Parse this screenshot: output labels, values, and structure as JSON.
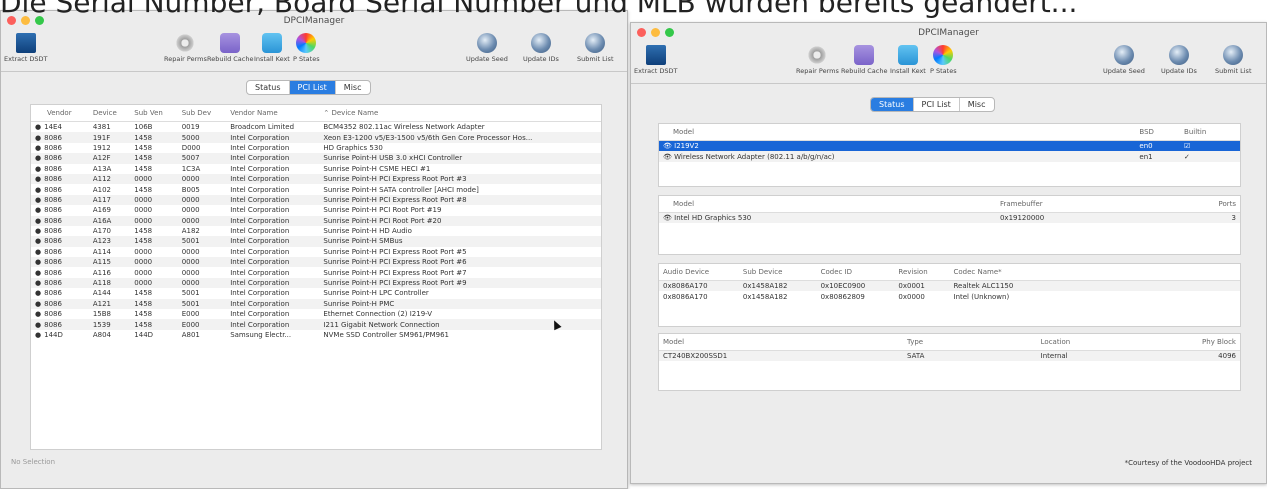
{
  "caption": "Die Serial Number, Board Serial Number und MLB wurden bereits geändert...",
  "left": {
    "title": "DPCIManager",
    "toolbar": [
      "Extract DSDT",
      "Repair Perms",
      "Rebuild Cache",
      "Install Kext",
      "P States",
      "Update Seed",
      "Update IDs",
      "Submit List"
    ],
    "tabs": [
      "Status",
      "PCI List",
      "Misc"
    ],
    "active_tab": "PCI List",
    "columns": [
      "Vendor",
      "Device",
      "Sub Ven",
      "Sub Dev",
      "Vendor Name",
      "Device Name"
    ],
    "rows": [
      [
        "14E4",
        "4381",
        "106B",
        "0019",
        "Broadcom Limited",
        "BCM4352 802.11ac Wireless Network Adapter"
      ],
      [
        "8086",
        "191F",
        "1458",
        "5000",
        "Intel Corporation",
        "Xeon E3-1200 v5/E3-1500 v5/6th Gen Core Processor Hos..."
      ],
      [
        "8086",
        "1912",
        "1458",
        "D000",
        "Intel Corporation",
        "HD Graphics 530"
      ],
      [
        "8086",
        "A12F",
        "1458",
        "5007",
        "Intel Corporation",
        "Sunrise Point-H USB 3.0 xHCI Controller"
      ],
      [
        "8086",
        "A13A",
        "1458",
        "1C3A",
        "Intel Corporation",
        "Sunrise Point-H CSME HECI #1"
      ],
      [
        "8086",
        "A112",
        "0000",
        "0000",
        "Intel Corporation",
        "Sunrise Point-H PCI Express Root Port #3"
      ],
      [
        "8086",
        "A102",
        "1458",
        "B005",
        "Intel Corporation",
        "Sunrise Point-H SATA controller [AHCI mode]"
      ],
      [
        "8086",
        "A117",
        "0000",
        "0000",
        "Intel Corporation",
        "Sunrise Point-H PCI Express Root Port #8"
      ],
      [
        "8086",
        "A169",
        "0000",
        "0000",
        "Intel Corporation",
        "Sunrise Point-H PCI Root Port #19"
      ],
      [
        "8086",
        "A16A",
        "0000",
        "0000",
        "Intel Corporation",
        "Sunrise Point-H PCI Root Port #20"
      ],
      [
        "8086",
        "A170",
        "1458",
        "A182",
        "Intel Corporation",
        "Sunrise Point-H HD Audio"
      ],
      [
        "8086",
        "A123",
        "1458",
        "5001",
        "Intel Corporation",
        "Sunrise Point-H SMBus"
      ],
      [
        "8086",
        "A114",
        "0000",
        "0000",
        "Intel Corporation",
        "Sunrise Point-H PCI Express Root Port #5"
      ],
      [
        "8086",
        "A115",
        "0000",
        "0000",
        "Intel Corporation",
        "Sunrise Point-H PCI Express Root Port #6"
      ],
      [
        "8086",
        "A116",
        "0000",
        "0000",
        "Intel Corporation",
        "Sunrise Point-H PCI Express Root Port #7"
      ],
      [
        "8086",
        "A118",
        "0000",
        "0000",
        "Intel Corporation",
        "Sunrise Point-H PCI Express Root Port #9"
      ],
      [
        "8086",
        "A144",
        "1458",
        "5001",
        "Intel Corporation",
        "Sunrise Point-H LPC Controller"
      ],
      [
        "8086",
        "A121",
        "1458",
        "5001",
        "Intel Corporation",
        "Sunrise Point-H PMC"
      ],
      [
        "8086",
        "15B8",
        "1458",
        "E000",
        "Intel Corporation",
        "Ethernet Connection (2) I219-V"
      ],
      [
        "8086",
        "1539",
        "1458",
        "E000",
        "Intel Corporation",
        "I211 Gigabit Network Connection"
      ],
      [
        "144D",
        "A804",
        "144D",
        "A801",
        "Samsung Electr...",
        "NVMe SSD Controller SM961/PM961"
      ]
    ],
    "status": "No Selection"
  },
  "right": {
    "title": "DPCIManager",
    "toolbar": [
      "Extract DSDT",
      "Repair Perms",
      "Rebuild Cache",
      "Install Kext",
      "P States",
      "Update Seed",
      "Update IDs",
      "Submit List"
    ],
    "tabs": [
      "Status",
      "PCI List",
      "Misc"
    ],
    "active_tab": "Status",
    "network": {
      "columns": [
        "Model",
        "BSD",
        "Builtin"
      ],
      "rows": [
        {
          "model": "I219V2",
          "bsd": "en0",
          "builtin": "☑"
        },
        {
          "model": "Wireless Network Adapter (802.11 a/b/g/n/ac)",
          "bsd": "en1",
          "builtin": "✓"
        }
      ]
    },
    "graphics": {
      "columns": [
        "Model",
        "Framebuffer",
        "Ports"
      ],
      "rows": [
        {
          "model": "Intel HD Graphics 530",
          "framebuffer": "0x19120000",
          "ports": "3"
        }
      ]
    },
    "audio": {
      "columns": [
        "Audio Device",
        "Sub Device",
        "Codec ID",
        "Revision",
        "Codec Name*"
      ],
      "rows": [
        [
          "0x8086A170",
          "0x1458A182",
          "0x10EC0900",
          "0x0001",
          "Realtek ALC1150"
        ],
        [
          "0x8086A170",
          "0x1458A182",
          "0x80862809",
          "0x0000",
          "Intel (Unknown)"
        ]
      ]
    },
    "storage": {
      "columns": [
        "Model",
        "Type",
        "Location",
        "Phy Block"
      ],
      "rows": [
        [
          "CT240BX200SSD1",
          "SATA",
          "Internal",
          "4096"
        ]
      ]
    },
    "footer": "*Courtesy of the VoodooHDA project"
  },
  "colors": {
    "accent": "#2a7de1",
    "selection": "#1865d6",
    "close": "#fc605c",
    "min": "#fdbc40",
    "max": "#34c84a"
  }
}
